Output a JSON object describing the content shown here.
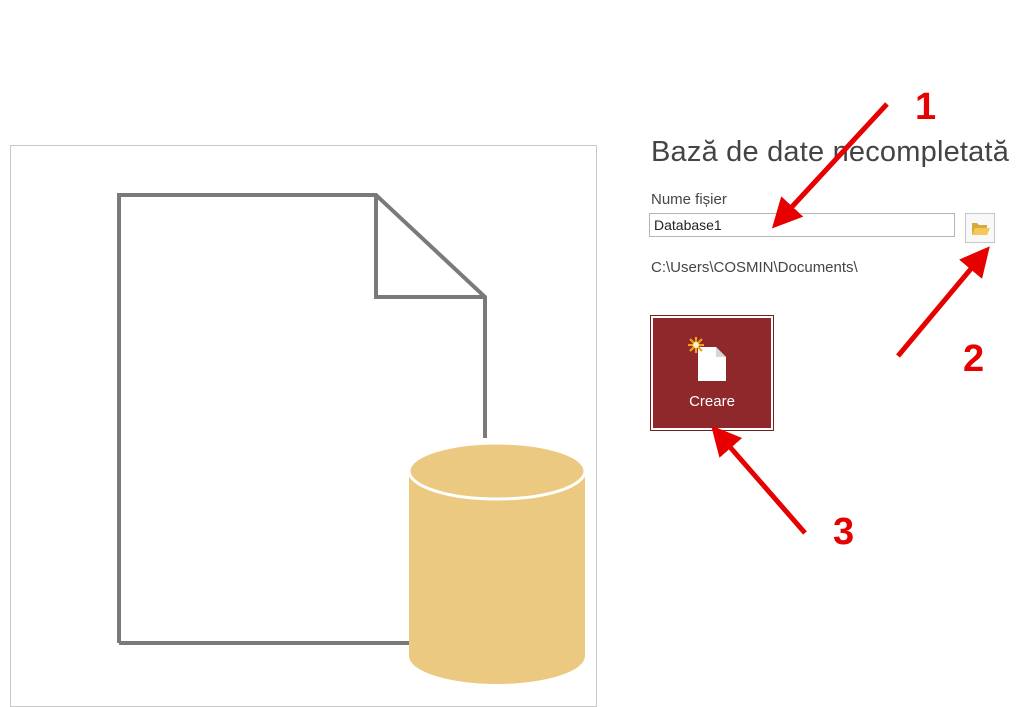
{
  "template": {
    "title": "Bază de date necompletată",
    "file_name_label": "Nume fișier",
    "file_name_value": "Database1",
    "path": "C:\\Users\\COSMIN\\Documents\\",
    "create_label": "Creare"
  },
  "annotations": [
    "1",
    "2",
    "3"
  ],
  "colors": {
    "create_button": "#8e282a",
    "database_fill": "#ecc981",
    "annotation": "#e60000",
    "outline_gray": "#7a7a7a"
  },
  "icons": [
    "blank-database-preview",
    "folder-icon",
    "new-document-icon"
  ]
}
